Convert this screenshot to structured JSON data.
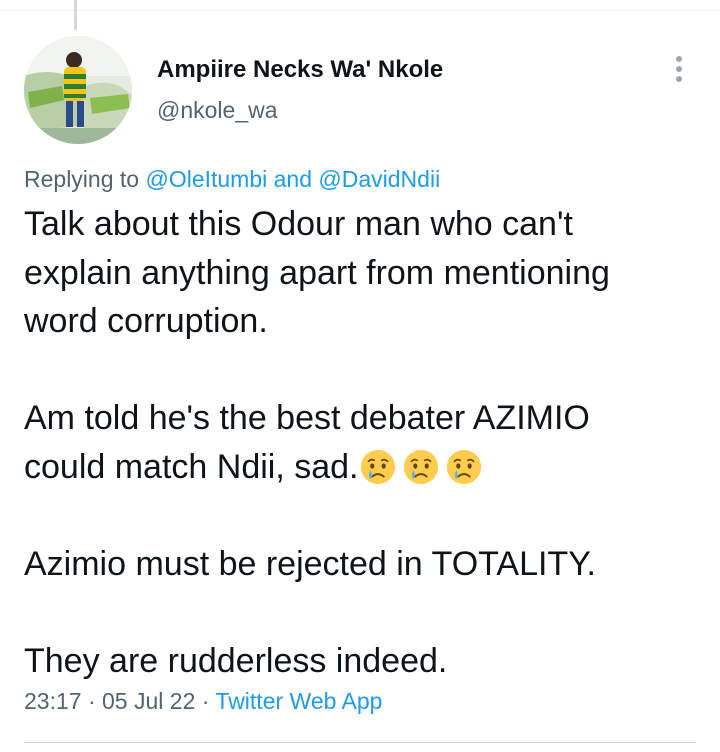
{
  "tweet": {
    "author_name": "Ampiire Necks Wa' Nkole",
    "author_handle": "@nkole_wa",
    "replying_prefix": "Replying to",
    "reply_mentions": [
      "@OleItumbi",
      "@DavidNdii"
    ],
    "reply_joiner": "and",
    "body_lines": [
      "Talk about this Odour man who can't",
      "explain anything apart from mentioning",
      "word corruption.",
      "Am told he's the best debater  AZIMIO",
      "could match Ndii,  sad.",
      "Azimio must be rejected in TOTALITY.",
      "They are rudderless indeed."
    ],
    "emoji_name": "crying-face-emoji",
    "emoji_count": 3,
    "time": "23:17",
    "date": "05 Jul 22",
    "separator": "·",
    "source": "Twitter Web App"
  },
  "colors": {
    "text": "#0f1419",
    "secondary": "#536471",
    "link": "#1d9bf0",
    "divider": "#cfd9de"
  }
}
